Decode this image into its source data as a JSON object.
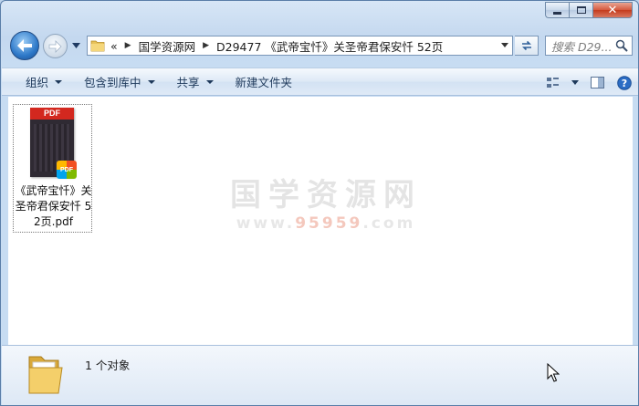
{
  "address": {
    "overflow": "«",
    "crumbs": [
      "国学资源网",
      "D29477 《武帝宝忏》关圣帝君保安忏 52页"
    ]
  },
  "search": {
    "placeholder": "搜索 D29..."
  },
  "toolbar": {
    "organize": "组织",
    "include_in_library": "包含到库中",
    "share": "共享",
    "new_folder": "新建文件夹"
  },
  "files": [
    {
      "name": "《武帝宝忏》关圣帝君保安忏 52页.pdf",
      "thumb_label": "PDF",
      "badge_label": "PDF",
      "icon": "pdf-icon"
    }
  ],
  "watermark": {
    "title": "国学资源网",
    "url_pre": "www.",
    "url_hl": "95959",
    "url_post": ".com"
  },
  "status": {
    "count": "1 个对象"
  },
  "colors": {
    "accent": "#2e79c9",
    "pdf_red": "#d3281f",
    "command_text": "#1e395b"
  }
}
